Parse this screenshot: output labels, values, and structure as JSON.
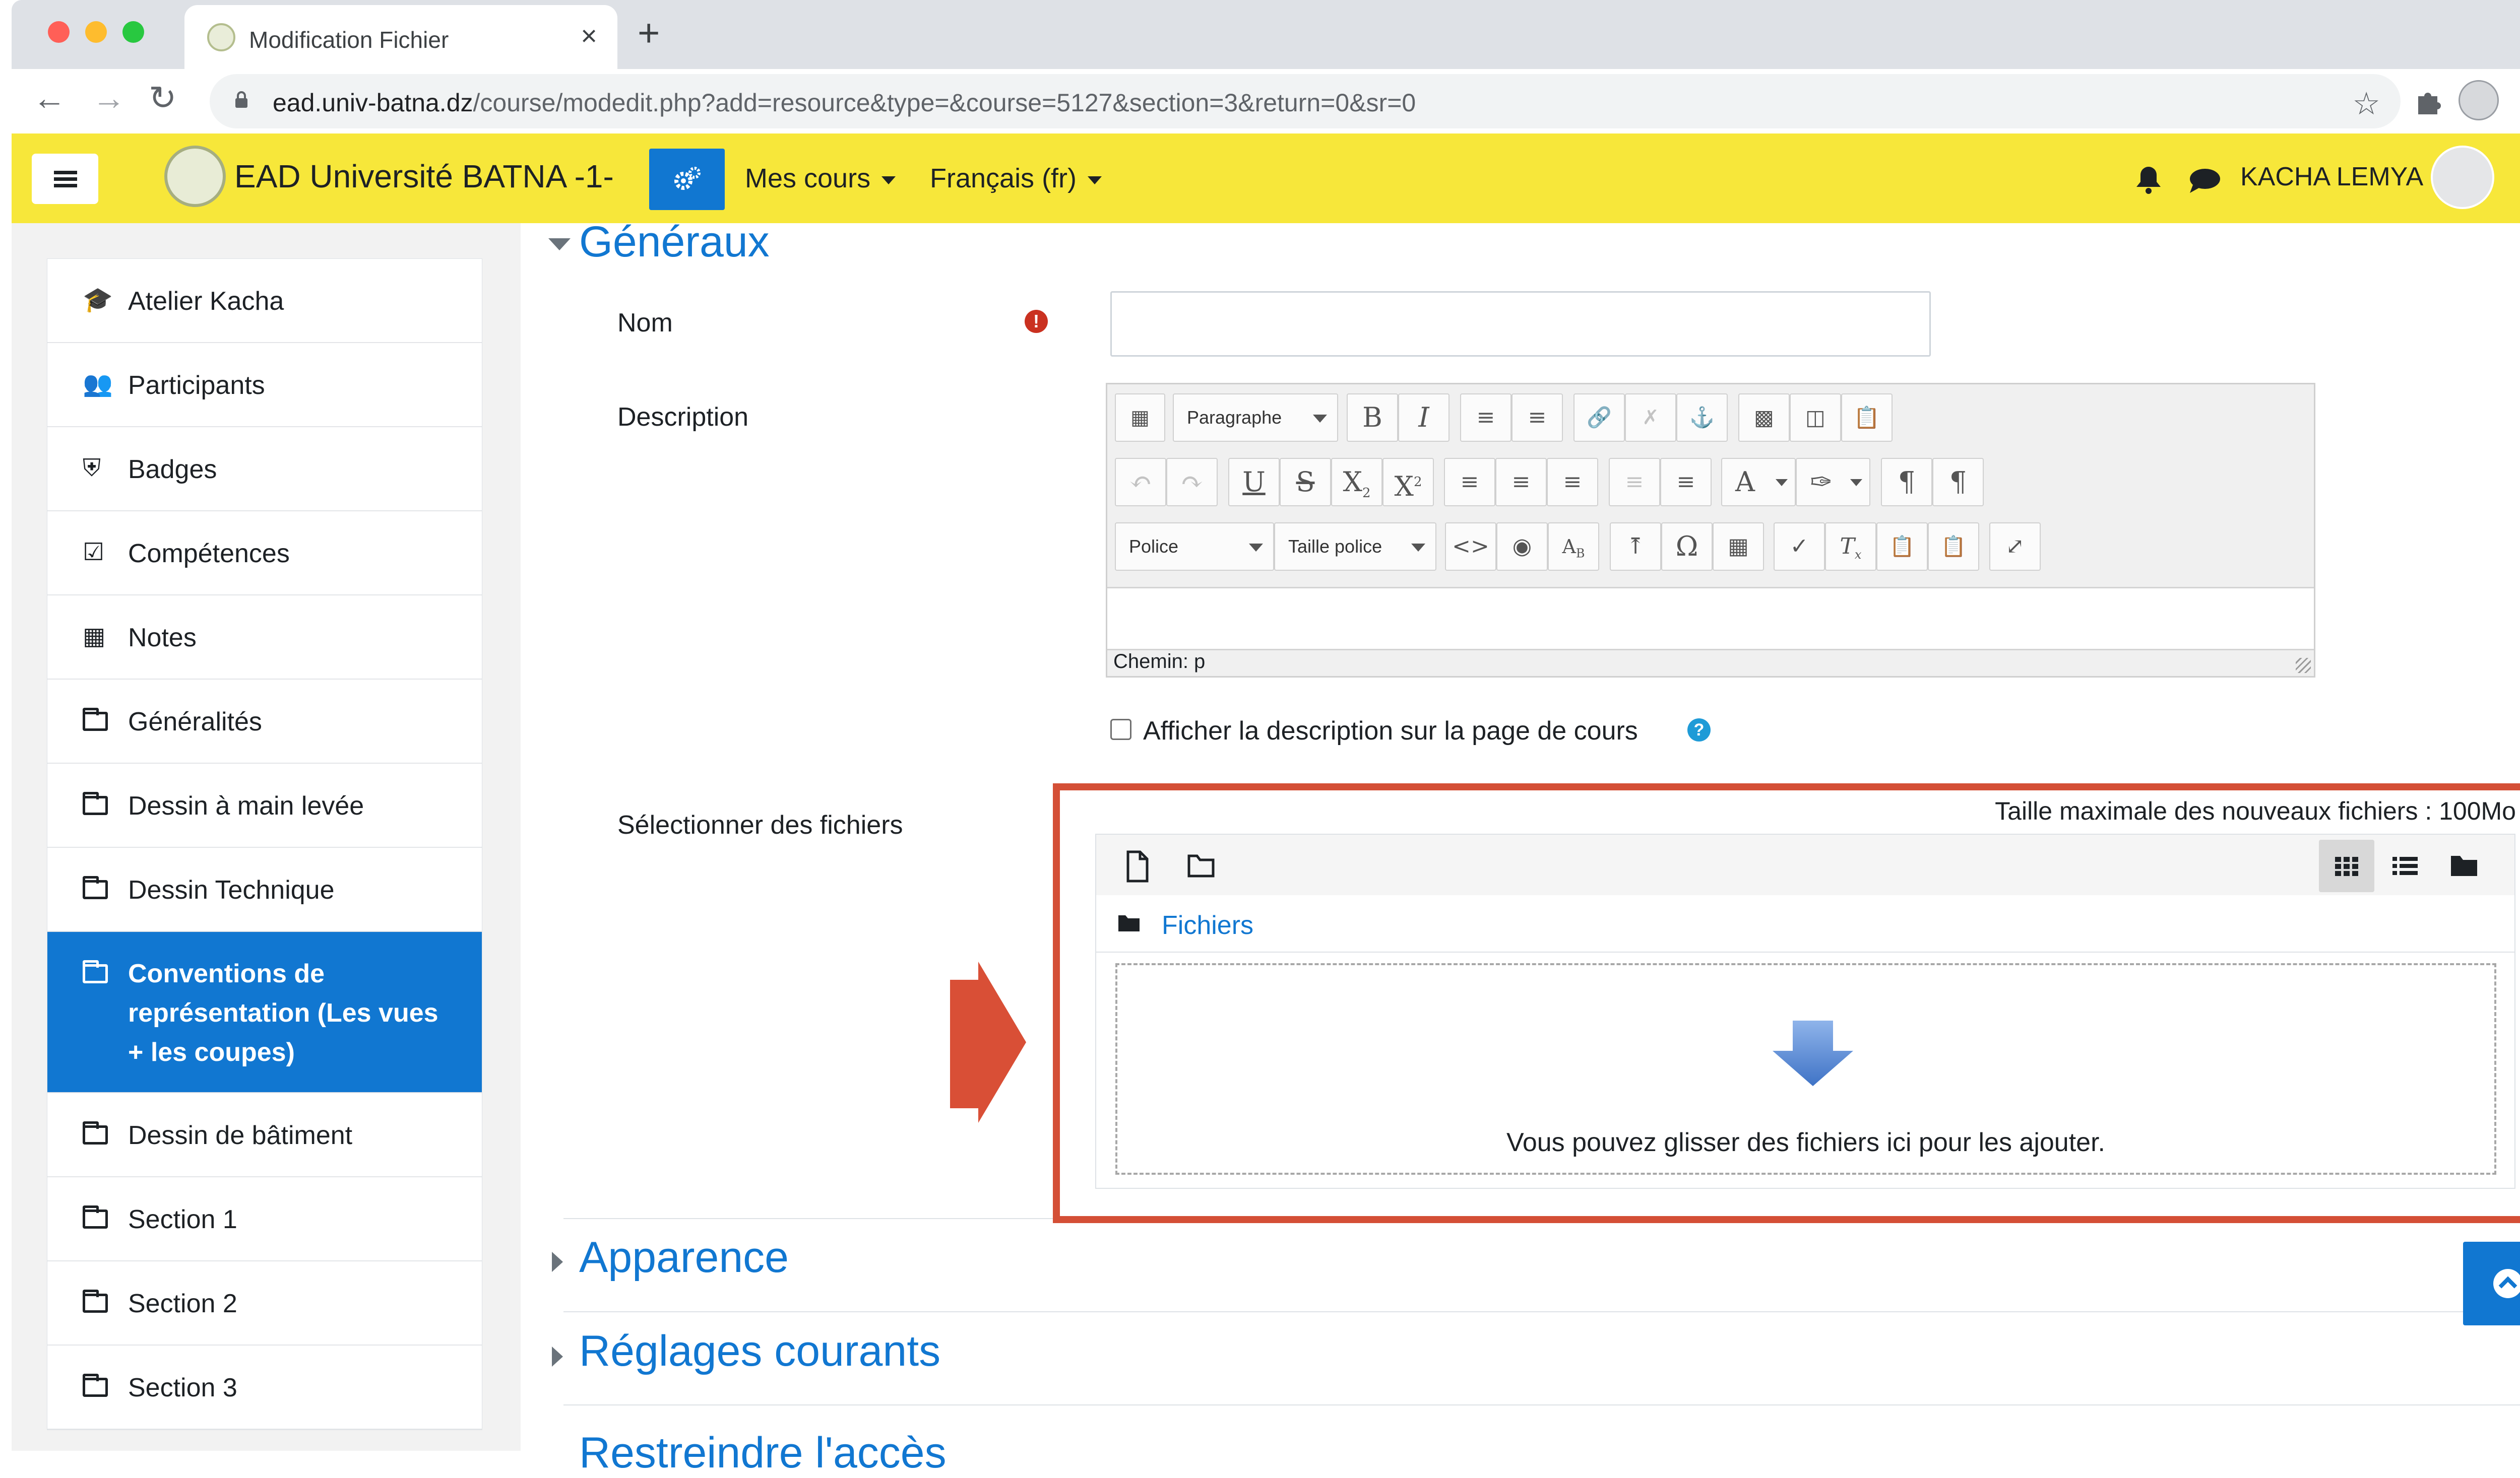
{
  "browser": {
    "tab_title": "Modification Fichier",
    "tab_close": "×",
    "new_tab": "+",
    "url_host": "ead.univ-batna.dz",
    "url_path": "/course/modedit.php?add=resource&type=&course=5127&section=3&return=0&sr=0",
    "traffic_colors": [
      "#ff5f57",
      "#febc2e",
      "#28c840"
    ]
  },
  "navbar": {
    "site_name": "EAD Université BATNA -1-",
    "menu_courses": "Mes cours",
    "menu_language": "Français (fr)",
    "user_name": "KACHA LEMYA",
    "background": "#f7e73a",
    "accent": "#1177d1"
  },
  "drawer": {
    "items": [
      {
        "label": "Atelier Kacha",
        "icon": "graduation-cap-icon"
      },
      {
        "label": "Participants",
        "icon": "users-icon"
      },
      {
        "label": "Badges",
        "icon": "shield-icon"
      },
      {
        "label": "Compétences",
        "icon": "checkbox-icon"
      },
      {
        "label": "Notes",
        "icon": "table-icon"
      },
      {
        "label": "Généralités",
        "icon": "folder-icon"
      },
      {
        "label": "Dessin à main levée",
        "icon": "folder-icon"
      },
      {
        "label": "Dessin Technique",
        "icon": "folder-icon"
      },
      {
        "label": "Conventions de représentation (Les vues + les coupes)",
        "icon": "folder-icon",
        "active": true
      },
      {
        "label": "Dessin de bâtiment",
        "icon": "folder-icon"
      },
      {
        "label": "Section 1",
        "icon": "folder-icon"
      },
      {
        "label": "Section 2",
        "icon": "folder-icon"
      },
      {
        "label": "Section 3",
        "icon": "folder-icon"
      }
    ]
  },
  "form": {
    "general_header": "Généraux",
    "name_label": "Nom",
    "name_value": "",
    "description_label": "Description",
    "editor": {
      "format_select": "Paragraphe",
      "font_select": "Police",
      "size_select": "Taille police",
      "path_text": "Chemin: p"
    },
    "show_description_label": "Afficher la description sur la page de cours",
    "show_description_checked": false,
    "files_label": "Sélectionner des fichiers",
    "max_size_text": "Taille maximale des nouveaux fichiers : 100Mo",
    "files_folder": "Fichiers",
    "drop_text": "Vous pouvez glisser des fichiers ici pour les ajouter.",
    "section_appearance": "Apparence",
    "section_common": "Réglages courants",
    "section_restrict_partial": "Restreindre l'accès"
  }
}
